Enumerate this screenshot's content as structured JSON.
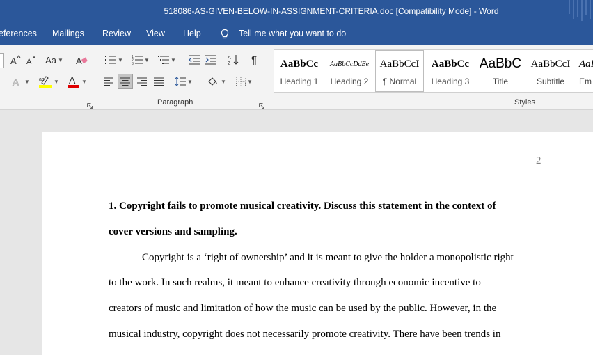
{
  "window": {
    "title": "518086-AS-GIVEN-BELOW-IN-ASSIGNMENT-CRITERIA.doc [Compatibility Mode]  -  Word"
  },
  "menu": {
    "items": [
      "eferences",
      "Mailings",
      "Review",
      "View",
      "Help"
    ],
    "tell_me": "Tell me what you want to do"
  },
  "ribbon": {
    "paragraph_label": "Paragraph",
    "styles_label": "Styles",
    "font": {
      "change_case": "Aa"
    },
    "styles": [
      {
        "sample": "AaBbCc",
        "name": "Heading 1"
      },
      {
        "sample": "AaBbCcDdEe",
        "name": "Heading 2"
      },
      {
        "sample": "AaBbCcI",
        "name": "¶ Normal"
      },
      {
        "sample": "AaBbCc",
        "name": "Heading 3"
      },
      {
        "sample": "AaBbC",
        "name": "Title"
      },
      {
        "sample": "AaBbCcI",
        "name": "Subtitle"
      },
      {
        "sample": "AaB",
        "name": "Em"
      }
    ]
  },
  "document": {
    "page_number": "2",
    "lines": [
      "1. Copyright fails to promote musical creativity. Discuss this statement in the context of",
      "cover versions and sampling.",
      "Copyright is a ‘right of ownership’ and it is meant to give the holder a monopolistic right",
      "to the work. In such realms, it meant to enhance creativity through economic incentive to",
      "creators of music and limitation of how the music can be used by the public. However, in the",
      "musical industry, copyright does not necessarily promote creativity. There have been trends in"
    ]
  },
  "colors": {
    "title_bar": "#2b579a",
    "ribbon_bg": "#f3f3f3",
    "canvas_bg": "#e6e6e6",
    "highlight": "#ffff00",
    "font_color": "#e00000"
  }
}
